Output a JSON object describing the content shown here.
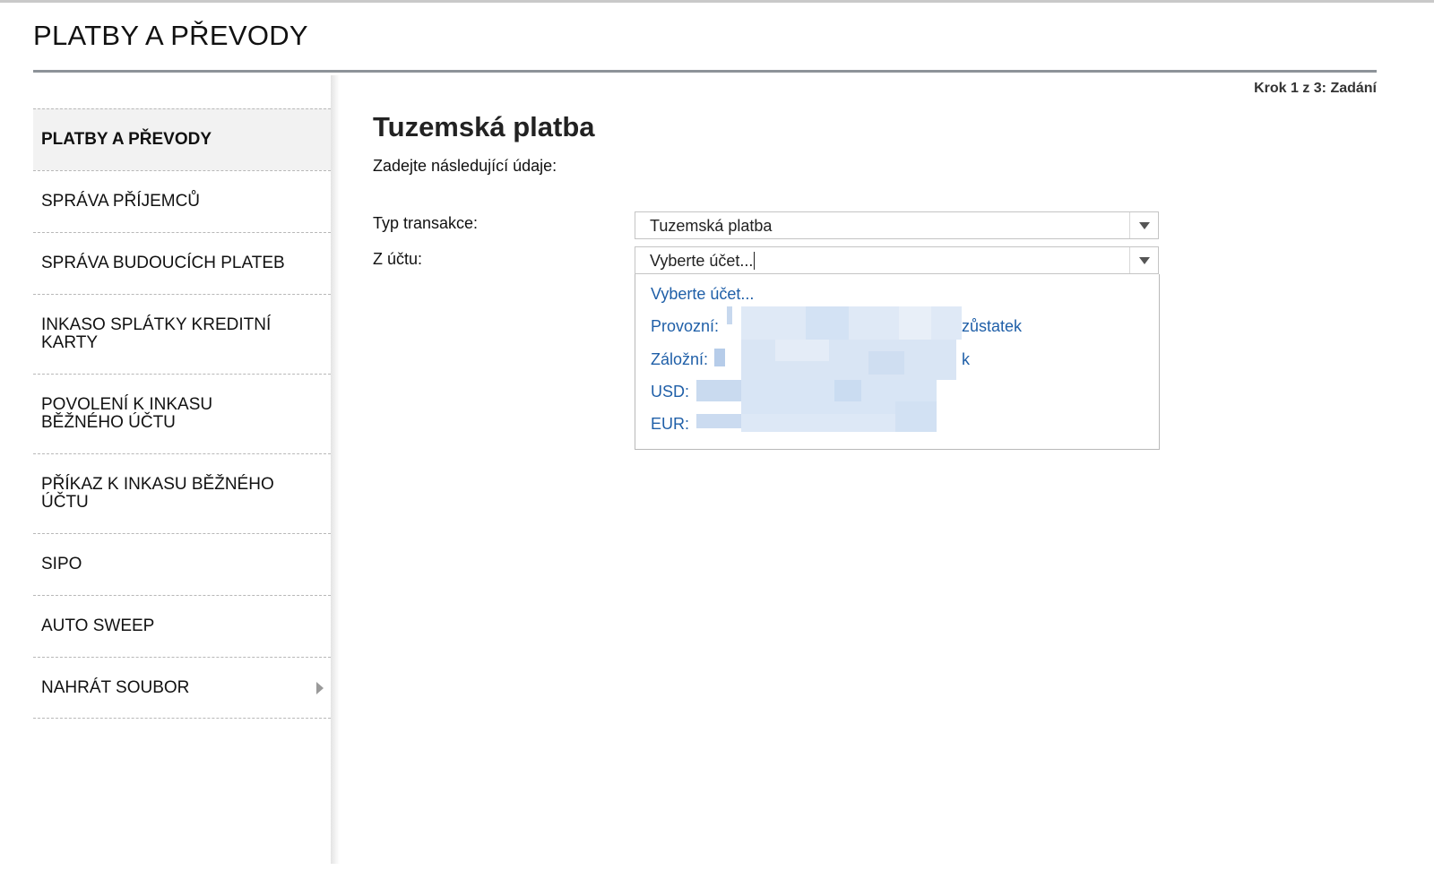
{
  "page": {
    "title": "PLATBY A PŘEVODY",
    "step": "Krok 1 z 3: Zadání"
  },
  "sidebar": {
    "items": [
      {
        "label": "PLATBY A PŘEVODY"
      },
      {
        "label": "SPRÁVA PŘÍJEMCŮ"
      },
      {
        "label": "SPRÁVA BUDOUCÍCH PLATEB"
      },
      {
        "label": "INKASO SPLÁTKY KREDITNÍ KARTY"
      },
      {
        "label": "POVOLENÍ K INKASU BĚŽNÉHO ÚČTU"
      },
      {
        "label": "PŘÍKAZ K INKASU BĚŽNÉHO ÚČTU"
      },
      {
        "label": "SIPO"
      },
      {
        "label": "AUTO SWEEP"
      },
      {
        "label": "NAHRÁT SOUBOR"
      }
    ]
  },
  "form": {
    "heading": "Tuzemská platba",
    "subheading": "Zadejte následující údaje:",
    "type_label": "Typ transakce:",
    "type_value": "Tuzemská platba",
    "account_label": "Z účtu:",
    "account_value": "Vyberte účet...",
    "account_options": [
      {
        "label": "Vyberte účet...",
        "tail": ""
      },
      {
        "label": "Provozní:",
        "tail": "zůstatek"
      },
      {
        "label": "Záložní:",
        "tail": "k"
      },
      {
        "label": "USD:",
        "tail": ""
      },
      {
        "label": "EUR:",
        "tail": ""
      }
    ]
  },
  "colors": {
    "link": "#1f5fa8",
    "rule": "#8d9398",
    "redaction": "#d6e3f3"
  }
}
